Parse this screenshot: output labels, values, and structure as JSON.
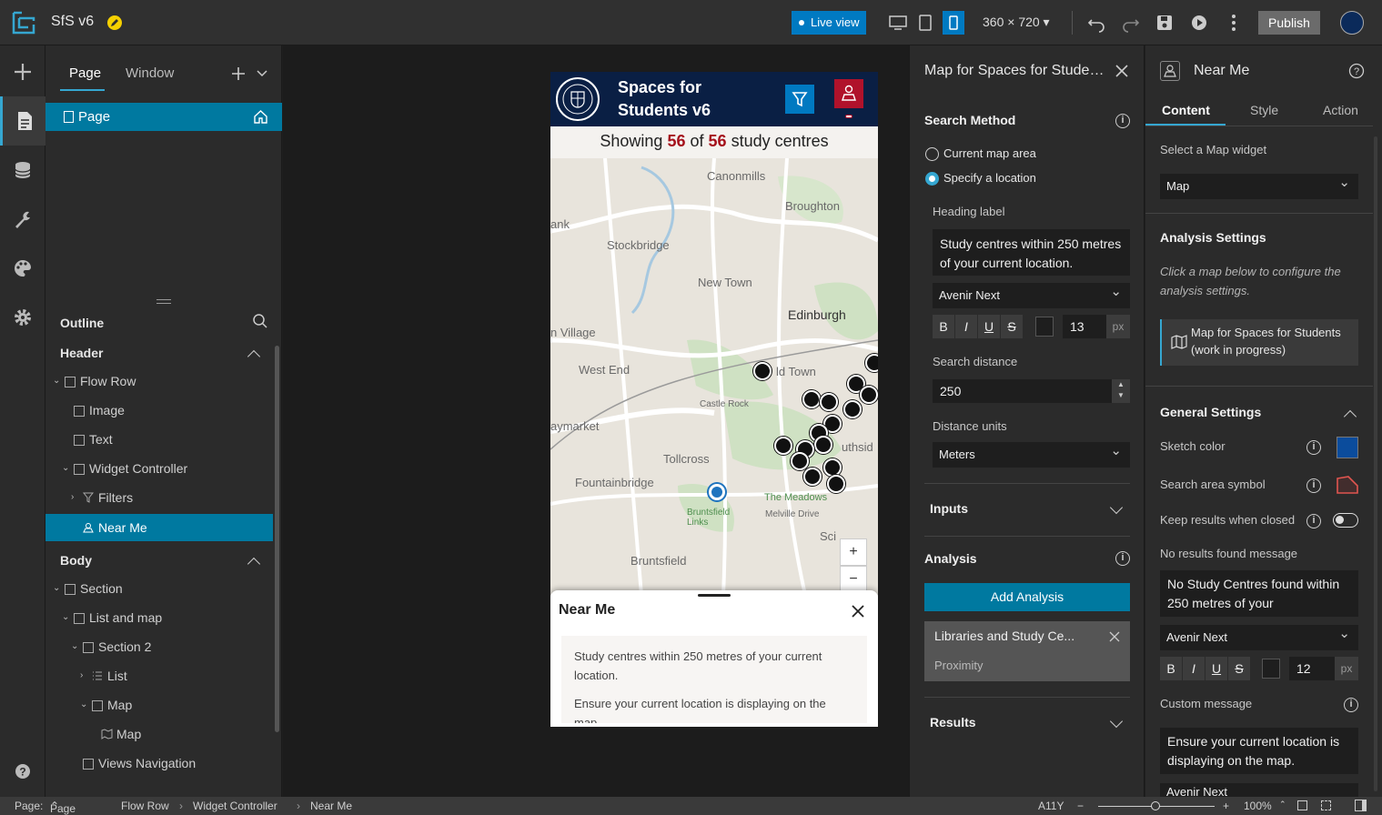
{
  "app": {
    "title": "SfS v6",
    "live_view": "Live view",
    "dimensions": "360 × 720",
    "publish": "Publish"
  },
  "page_panel": {
    "tabs": [
      "Page",
      "Window"
    ],
    "page_item": "Page",
    "outline_label": "Outline",
    "header_label": "Header",
    "body_label": "Body",
    "tree": [
      {
        "label": "Flow Row",
        "icon": "flow-row-icon"
      },
      {
        "label": "Image",
        "icon": "image-icon"
      },
      {
        "label": "Text",
        "icon": "text-icon"
      },
      {
        "label": "Widget Controller",
        "icon": "widget-controller-icon"
      },
      {
        "label": "Filters",
        "icon": "filter-icon"
      },
      {
        "label": "Near Me",
        "icon": "near-me-icon"
      },
      {
        "label": "Section",
        "icon": "section-icon"
      },
      {
        "label": "List and map",
        "icon": "section-icon"
      },
      {
        "label": "Section 2",
        "icon": "section-icon"
      },
      {
        "label": "List",
        "icon": "list-icon"
      },
      {
        "label": "Map",
        "icon": "map-icon"
      },
      {
        "label": "Map",
        "icon": "map-icon"
      },
      {
        "label": "Views Navigation",
        "icon": "views-navigation-icon"
      }
    ]
  },
  "phone": {
    "app_title": "Spaces for Students v6",
    "showing_prefix": "Showing",
    "showing_count": "56",
    "showing_of": "of",
    "showing_total": "56",
    "showing_suffix": "study centres",
    "map_labels": [
      "Canonmills",
      "Broughton",
      "Stockbridge",
      "New Town",
      "Edinburgh",
      "n Village",
      "West End",
      "ld Town",
      "Castle Rock",
      "aymarket",
      "Tollcross",
      "Fountainbridge",
      "The Meadows",
      "Bruntsfield Links",
      "Melville Drive",
      "Bruntsfield",
      "ank",
      "uthsid",
      "Sci"
    ],
    "sheet_title": "Near Me",
    "sheet_message": "Study centres within 250 metres of your current location.",
    "sheet_message_2": "Ensure your current location is displaying on the map."
  },
  "mid_panel": {
    "title": "Map for Spaces for Students (work in progress)",
    "search_method": "Search Method",
    "radio_1": "Current map area",
    "radio_2": "Specify a location",
    "heading_label": "Heading label",
    "heading_value": "Study centres within 250 metres of your current location.",
    "font": "Avenir Next",
    "font_size": "13",
    "px": "px",
    "search_distance": "Search distance",
    "search_distance_value": "250",
    "distance_units": "Distance units",
    "distance_units_value": "Meters",
    "inputs": "Inputs",
    "analysis": "Analysis",
    "add_analysis": "Add Analysis",
    "analysis_card_title": "Libraries and Study Ce...",
    "analysis_card_sub": "Proximity",
    "results": "Results"
  },
  "right_panel": {
    "title": "Near Me",
    "tabs": [
      "Content",
      "Style",
      "Action"
    ],
    "select_map_widget": "Select a Map widget",
    "map_value": "Map",
    "analysis_settings": "Analysis Settings",
    "analysis_hint": "Click a map below to configure the analysis settings.",
    "map_item": "Map for Spaces for Students (work in progress)",
    "general_settings": "General Settings",
    "sketch_color": "Sketch color",
    "sketch_color_value": "#0b4c9c",
    "search_area_symbol": "Search area symbol",
    "keep_results": "Keep results when closed",
    "no_results_label": "No results found message",
    "no_results_value": "No Study Centres found within 250 metres of your",
    "font": "Avenir Next",
    "font_size": "12",
    "px": "px",
    "custom_message": "Custom message",
    "custom_message_value": "Ensure your current location is displaying on the map.",
    "font_cut": "Avenir Next"
  },
  "status": {
    "page_label": "Page:",
    "page_value": "Page",
    "breadcrumb": [
      "Flow Row",
      "Widget Controller",
      "Near Me"
    ],
    "a11y": "A11Y",
    "zoom": "100%"
  }
}
